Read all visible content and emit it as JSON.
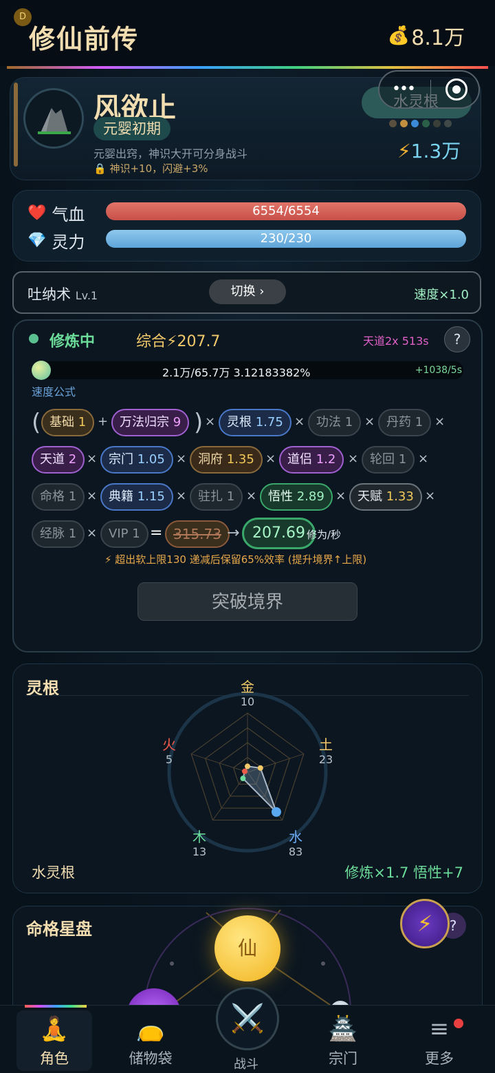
{
  "header": {
    "badge": "D",
    "title": "修仙前传",
    "money": "8.1万"
  },
  "profile": {
    "name": "风欲止",
    "realm": "元婴初期",
    "desc": "元婴出窍，神识大开可分身战斗",
    "lock": "神识+10，闪避+3%",
    "spirit_root": "水灵根",
    "power": "1.3万",
    "gem_colors": [
      "#5a5040",
      "#c09040",
      "#3a8ad8",
      "#2a6048",
      "#3a4038",
      "#404848"
    ]
  },
  "stats": {
    "hp_label": "气血",
    "hp": "6554/6554",
    "hp_fill": 1.0,
    "mp_label": "灵力",
    "mp": "230/230",
    "mp_fill": 1.0
  },
  "technique": {
    "name": "吐纳术",
    "level": "Lv.1",
    "switch_label": "切换 ›",
    "speed": "速度×1.0"
  },
  "cultivation": {
    "status": "修炼中",
    "composite": "综合⚡207.7",
    "tiandao": "天道2x 513s",
    "help": "?",
    "progress_text": "2.1万/65.7万  3.12183382%",
    "progress_fraction": 0.0312,
    "rate": "+1038/5s",
    "formula_label": "速度公式",
    "chips": [
      {
        "name": "基础",
        "val": "1"
      },
      {
        "name": "万法归宗",
        "val": "9"
      },
      {
        "name": "灵根",
        "val": "1.75"
      },
      {
        "name": "功法",
        "val": "1"
      },
      {
        "name": "丹药",
        "val": "1"
      },
      {
        "name": "天道",
        "val": "2"
      },
      {
        "name": "宗门",
        "val": "1.05"
      },
      {
        "name": "洞府",
        "val": "1.35"
      },
      {
        "name": "道侣",
        "val": "1.2"
      },
      {
        "name": "轮回",
        "val": "1"
      },
      {
        "name": "命格",
        "val": "1"
      },
      {
        "name": "典籍",
        "val": "1.15"
      },
      {
        "name": "驻扎",
        "val": "1"
      },
      {
        "name": "悟性",
        "val": "2.89"
      },
      {
        "name": "天赋",
        "val": "1.33"
      },
      {
        "name": "经脉",
        "val": "1"
      },
      {
        "name": "VIP",
        "val": "1"
      }
    ],
    "ops": {
      "plus": "+",
      "times": "×",
      "equals": "=",
      "lparen": "(",
      "rparen": ")",
      "arrow": "→"
    },
    "raw": "315.73",
    "result": "207.69",
    "unit": "修为/秒",
    "warning": "⚡ 超出软上限130 递减后保留65%效率 (提升境界↑上限)",
    "break_label": "突破境界"
  },
  "spirit_roots": {
    "title": "灵根",
    "metal_label": "金",
    "metal": "10",
    "earth_label": "土",
    "earth": "23",
    "water_label": "水",
    "water": "83",
    "wood_label": "木",
    "wood": "13",
    "fire_label": "火",
    "fire": "5",
    "max": 100,
    "root_name": "水灵根",
    "bonus": "修炼×1.7  悟性+7"
  },
  "fate": {
    "title": "命格星盘",
    "center": "仙",
    "help": "?"
  },
  "tabs": [
    {
      "label": "角色"
    },
    {
      "label": "储物袋"
    },
    {
      "label": "战斗"
    },
    {
      "label": "宗门"
    },
    {
      "label": "更多"
    }
  ]
}
